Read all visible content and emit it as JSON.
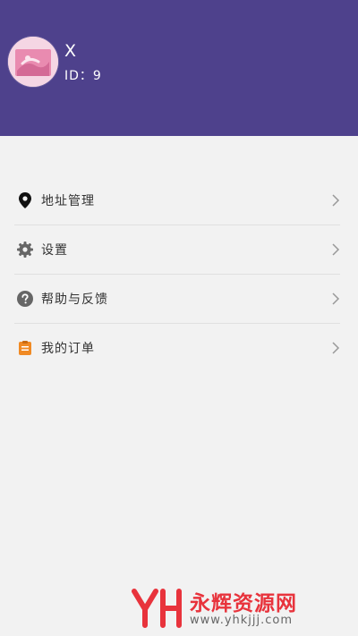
{
  "profile": {
    "name": "X",
    "id_text": "ID：9"
  },
  "menu": [
    {
      "label": "地址管理",
      "icon": "location-pin-icon"
    },
    {
      "label": "设置",
      "icon": "gear-icon"
    },
    {
      "label": "帮助与反馈",
      "icon": "help-circle-icon"
    },
    {
      "label": "我的订单",
      "icon": "order-clipboard-icon"
    }
  ],
  "watermark": {
    "text": "永辉资源网",
    "url": "www.yhkjjj.com"
  },
  "colors": {
    "header": "#4e418c",
    "background": "#f2f2f2",
    "order_icon": "#f08a24",
    "watermark": "#e8333c"
  }
}
